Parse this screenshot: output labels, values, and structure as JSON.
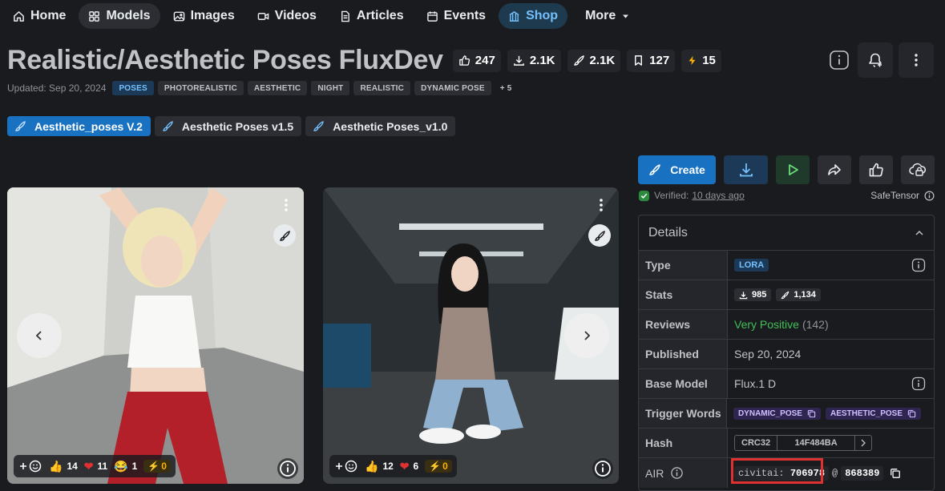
{
  "nav": {
    "items": [
      {
        "label": "Home",
        "icon": "home-icon"
      },
      {
        "label": "Models",
        "icon": "grid-icon",
        "active": true
      },
      {
        "label": "Images",
        "icon": "photo-icon"
      },
      {
        "label": "Videos",
        "icon": "video-icon"
      },
      {
        "label": "Articles",
        "icon": "article-icon"
      },
      {
        "label": "Events",
        "icon": "calendar-icon"
      },
      {
        "label": "Shop",
        "icon": "shop-icon"
      },
      {
        "label": "More",
        "icon": "chevron-down-icon"
      }
    ]
  },
  "model": {
    "title": "Realistic/Aesthetic Poses FluxDev",
    "stats": {
      "likes": "247",
      "downloads": "2.1K",
      "generations": "2.1K",
      "bookmarks": "127",
      "buzz": "15"
    },
    "updated": "Updated: Sep 20, 2024",
    "tags": [
      "POSES",
      "PHOTOREALISTIC",
      "AESTHETIC",
      "NIGHT",
      "REALISTIC",
      "DYNAMIC POSE"
    ],
    "tags_more": "+ 5"
  },
  "versions": [
    "Aesthetic_poses V.2",
    "Aesthetic Poses v1.5",
    "Aesthetic Poses_v1.0"
  ],
  "images": [
    {
      "reactions": {
        "like": "14",
        "heart": "11",
        "laugh": "1",
        "buzz": "0"
      }
    },
    {
      "reactions": {
        "like": "12",
        "heart": "6",
        "buzz": "0"
      }
    }
  ],
  "actions": {
    "create_label": "Create"
  },
  "verified": {
    "label": "Verified:",
    "when": "10 days ago",
    "format": "SafeTensor"
  },
  "details": {
    "heading": "Details",
    "labels": {
      "type": "Type",
      "stats": "Stats",
      "reviews": "Reviews",
      "published": "Published",
      "base_model": "Base Model",
      "trigger": "Trigger Words",
      "hash": "Hash",
      "air": "AIR"
    },
    "type": "LORA",
    "stats_downloads": "985",
    "stats_generations": "1,134",
    "reviews_rating": "Very Positive",
    "reviews_count": "(142)",
    "published": "Sep 20, 2024",
    "base_model": "Flux.1 D",
    "trigger_words": [
      "DYNAMIC_POSE",
      "AESTHETIC_POSE"
    ],
    "hash_type": "CRC32",
    "hash_value": "14F484BA",
    "air_prefix": "civitai:",
    "air_model": "706978",
    "air_at": "@",
    "air_version": "868389"
  },
  "colors": {
    "bg": "#1a1b1e",
    "primary": "#1971c2",
    "panel": "#25262b",
    "positive": "#40c057",
    "highlight": "#e03131"
  }
}
